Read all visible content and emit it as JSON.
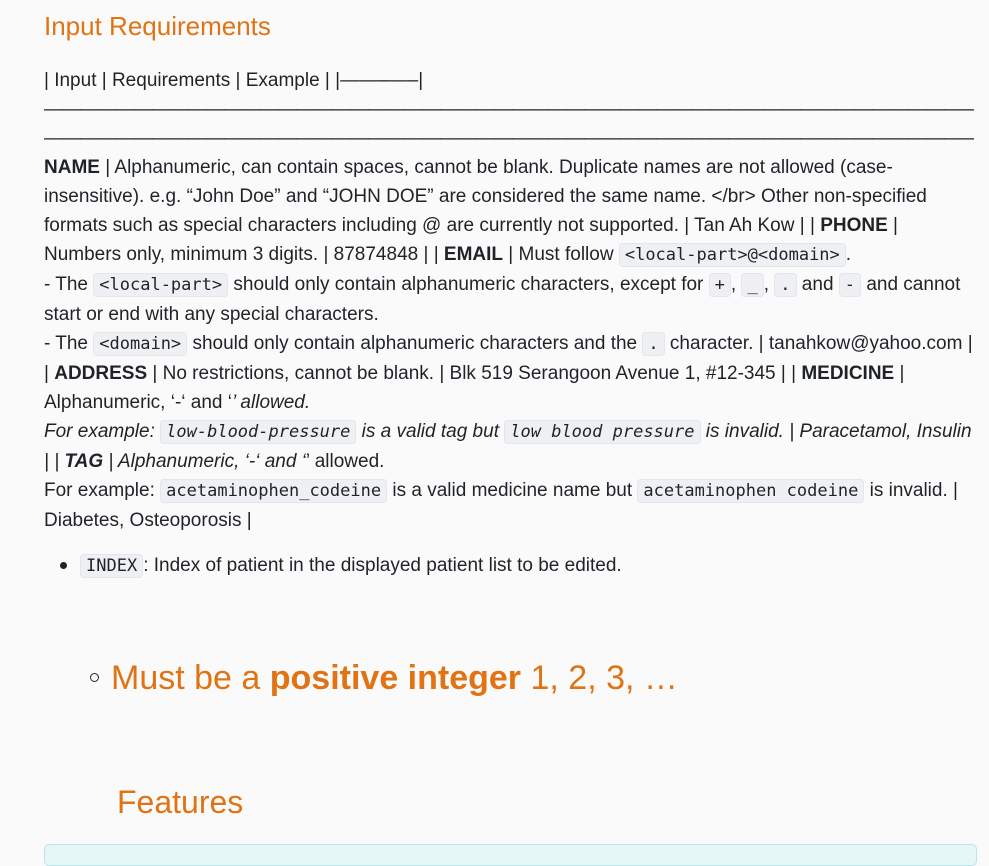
{
  "heading": "Input Requirements",
  "table_header_text": "| Input | Requirements | Example | |——–—–|",
  "dash_line_1": "————————————————————————————————————————————————————————————————————————————————————————————————————",
  "dash_line_2": "——————————————————————————————————————————————————————-|——————————————-| |",
  "rows": {
    "name_label": "NAME",
    "name_text": " | Alphanumeric, can contain spaces, cannot be blank. Duplicate names are not allowed (case-insensitive). e.g. “John Doe” and “JOHN DOE” are considered the same name. </br> Other non-specified formats such as special characters including @ are currently not supported. | Tan Ah Kow | | ",
    "phone_label": "PHONE",
    "phone_text": " | Numbers only, minimum 3 digits. | 87874848 | | ",
    "email_label": "EMAIL",
    "email_text": " | Must follow ",
    "email_format_code": "<local-part>@<domain>",
    "email_period": ".",
    "local_prefix": "- The ",
    "local_code": "<local-part>",
    "local_text": " should only contain alphanumeric characters, except for ",
    "plus_code": "+",
    "underscore_code": "_",
    "dot_code": ".",
    "and_word": " and ",
    "dash_code": "-",
    "local_end": " and cannot start or end with any special characters.",
    "domain_prefix": "- The ",
    "domain_code": "<domain>",
    "domain_text": " should only contain alphanumeric characters and the ",
    "domain_dot_code": ".",
    "domain_end": " character. | tanahkow@yahoo.com | | ",
    "address_label": "ADDRESS",
    "address_text": " | No restrictions, cannot be blank. | Blk 519 Serangoon Avenue 1, #12-345 | | ",
    "medicine_label": "MEDICINE",
    "medicine_text": " | Alphanumeric, ‘-‘ and ‘",
    "medicine_italic": "’ allowed.",
    "tag_example_prefix": "For example: ",
    "tag_valid_code": "low-blood-pressure",
    "tag_mid": " is a valid tag but ",
    "tag_invalid_code": "low blood pressure",
    "tag_end": " is invalid. | Paracetamol, Insulin | | ",
    "tag_label": "TAG",
    "tag_text": " | Alphanumeric, ‘-‘ and ‘",
    "tag_text2": "’ allowed.",
    "med_example_prefix": "For example: ",
    "med_valid_code": "acetaminophen_codeine",
    "med_mid": " is a valid medicine name but ",
    "med_invalid_code": "acetaminophen codeine",
    "med_end": " is invalid. | Diabetes, Osteoporosis |"
  },
  "index_item": {
    "code": "INDEX",
    "text": ": Index of patient in the displayed patient list to be edited."
  },
  "sub_item": {
    "prefix": "Must be a ",
    "bold": "positive integer",
    "suffix": " 1, 2, 3, …"
  },
  "features_heading": "Features"
}
